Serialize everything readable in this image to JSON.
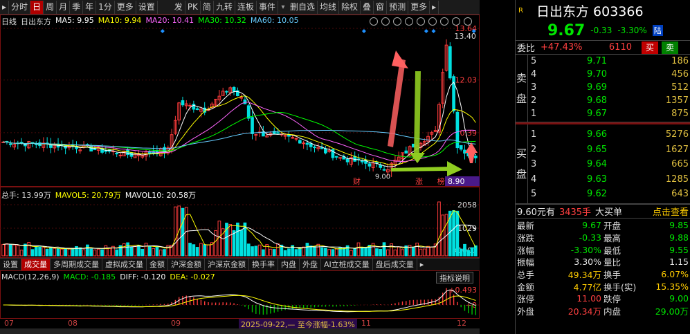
{
  "toolbar": {
    "items": [
      "分时",
      "日",
      "周",
      "月",
      "季",
      "年",
      "1分",
      "更多",
      "设置"
    ],
    "active_index": 1,
    "items_right": [
      "发",
      "PK",
      "简",
      "九转",
      "连板",
      "事件"
    ],
    "items_right2": [
      "删自选",
      "均线",
      "除权",
      "叠",
      "窗",
      "预测",
      "更多"
    ]
  },
  "main": {
    "legend": {
      "period": "日线",
      "stock": "日出东方",
      "ma5": "MA5: 9.95",
      "ma10": "MA10: 9.94",
      "ma20": "MA20: 10.41",
      "ma30": "MA30: 10.32",
      "ma60": "MA60: 10.05"
    },
    "price_axis": [
      "13.64",
      "12.03",
      "10.39"
    ],
    "current_price_tag": "8.90",
    "high_label": "13.40",
    "low_label": "9.00",
    "marker_cai": "财",
    "marker_zhang": "涨",
    "marker_bang": "榜"
  },
  "volume": {
    "legend": {
      "total": "总手: 13.99万",
      "mavol5": "MAVOL5: 20.79万",
      "mavol10": "MAVOL10: 20.58万"
    },
    "axis": [
      "2058",
      "1029",
      "X1000"
    ]
  },
  "indicator_tabs": [
    "设置",
    "成交量",
    "多周期成交量",
    "虚拟成交量",
    "金额",
    "沪深金额",
    "沪深京金额",
    "换手率",
    "内盘",
    "外盘",
    "AI立桩成交量",
    "盘后成交量"
  ],
  "indicator_active_index": 1,
  "macd": {
    "legend": {
      "name": "MACD(12,26,9)",
      "macd": "MACD: -0.185",
      "diff": "DIFF: -0.120",
      "dea": "DEA: -0.027"
    },
    "explain_button": "指标说明",
    "axis": [
      "+0.493",
      "+0"
    ]
  },
  "date_axis": {
    "labels": [
      "07",
      "08",
      "09",
      "11",
      "12"
    ],
    "range_label": "2025-09-22,— 至今涨幅-1.63%"
  },
  "right": {
    "market_flag": "R",
    "title": "日出东方 603366",
    "price": "9.67",
    "change": "-0.33",
    "change_pct": "-3.30%",
    "market": "陆",
    "weibi_label": "委比",
    "weibi_pct": "+47.43%",
    "weibi_vol": "6110",
    "sell_button": "买",
    "buy_button": "卖",
    "sell_side_label": [
      "卖",
      "盘"
    ],
    "buy_side_label": [
      "买",
      "盘"
    ],
    "asks": [
      {
        "level": "5",
        "price": "9.71",
        "vol": "186"
      },
      {
        "level": "4",
        "price": "9.70",
        "vol": "456"
      },
      {
        "level": "3",
        "price": "9.69",
        "vol": "512"
      },
      {
        "level": "2",
        "price": "9.68",
        "vol": "1357"
      },
      {
        "level": "1",
        "price": "9.67",
        "vol": "875"
      }
    ],
    "bids": [
      {
        "level": "1",
        "price": "9.66",
        "vol": "5276"
      },
      {
        "level": "2",
        "price": "9.65",
        "vol": "1627"
      },
      {
        "level": "3",
        "price": "9.64",
        "vol": "665"
      },
      {
        "level": "4",
        "price": "9.63",
        "vol": "1285"
      },
      {
        "level": "5",
        "price": "9.62",
        "vol": "643"
      }
    ],
    "trade": {
      "price": "9.60元有",
      "hands": "3435手",
      "type": "大买单",
      "link": "点击查看"
    },
    "stats": [
      {
        "k1": "最新",
        "v1": "9.67",
        "c1": "green",
        "k2": "开盘",
        "v2": "9.85",
        "c2": "green"
      },
      {
        "k1": "涨跌",
        "v1": "-0.33",
        "c1": "green",
        "k2": "最高",
        "v2": "9.88",
        "c2": "green"
      },
      {
        "k1": "涨幅",
        "v1": "-3.30%",
        "c1": "green",
        "k2": "最低",
        "v2": "9.55",
        "c2": "green"
      },
      {
        "k1": "振幅",
        "v1": "3.30%",
        "c1": "white",
        "k2": "量比",
        "v2": "1.15",
        "c2": "white"
      },
      {
        "k1": "总手",
        "v1": "49.34万",
        "c1": "yellow",
        "k2": "换手",
        "v2": "6.07%",
        "c2": "yellow"
      },
      {
        "k1": "金额",
        "v1": "4.77亿",
        "c1": "yellow",
        "k2": "换手(实)",
        "v2": "15.35%",
        "c2": "yellow"
      },
      {
        "k1": "涨停",
        "v1": "11.00",
        "c1": "red",
        "k2": "跌停",
        "v2": "9.00",
        "c2": "green"
      },
      {
        "k1": "外盘",
        "v1": "20.34万",
        "c1": "red",
        "k2": "内盘",
        "v2": "29.00万",
        "c2": "green"
      }
    ]
  },
  "colors": {
    "up": "#ff3c3c",
    "up_bar": "#5ff5f5",
    "down": "#00e0e0",
    "ma5": "#ffffff",
    "ma10": "#ffff00",
    "ma20": "#ff66ff",
    "ma30": "#00ff00",
    "ma60": "#66ccff",
    "accent_red": "#b00000"
  }
}
